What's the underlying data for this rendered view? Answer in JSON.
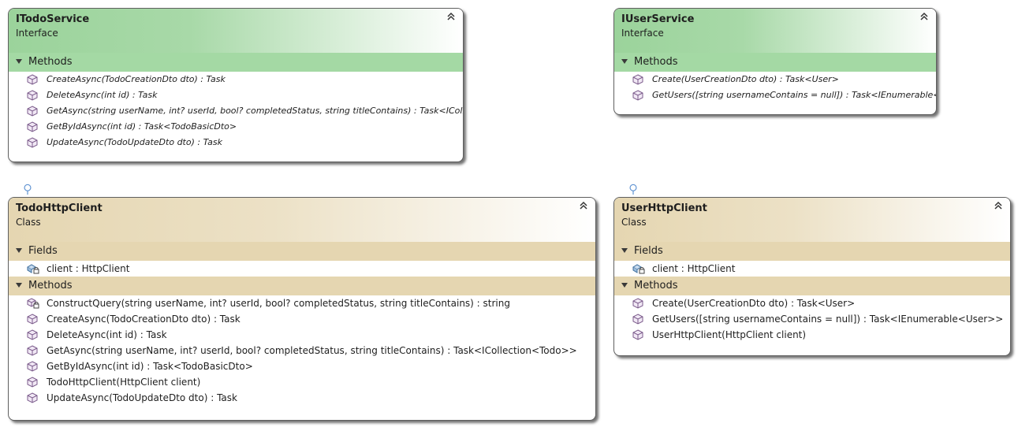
{
  "boxes": {
    "itodo": {
      "name": "ITodoService",
      "kind": "Interface",
      "sections": [
        {
          "title": "Methods",
          "members": [
            "CreateAsync(TodoCreationDto dto) : Task",
            "DeleteAsync(int id) : Task",
            "GetAsync(string userName, int? userId, bool? completedStatus, string titleContains) : Task<ICollection<Todo>>",
            "GetByIdAsync(int id) : Task<TodoBasicDto>",
            "UpdateAsync(TodoUpdateDto dto) : Task"
          ]
        }
      ]
    },
    "iuser": {
      "name": "IUserService",
      "kind": "Interface",
      "sections": [
        {
          "title": "Methods",
          "members": [
            "Create(UserCreationDto dto) : Task<User>",
            "GetUsers([string usernameContains = null]) : Task<IEnumerable<User>>"
          ]
        }
      ]
    },
    "todoclient": {
      "name": "TodoHttpClient",
      "kind": "Class",
      "sections": [
        {
          "title": "Fields",
          "members": [
            "client : HttpClient"
          ]
        },
        {
          "title": "Methods",
          "members": [
            "ConstructQuery(string userName, int? userId, bool? completedStatus, string titleContains) : string",
            "CreateAsync(TodoCreationDto dto) : Task",
            "DeleteAsync(int id) : Task",
            "GetAsync(string userName, int? userId, bool? completedStatus, string titleContains) : Task<ICollection<Todo>>",
            "GetByIdAsync(int id) : Task<TodoBasicDto>",
            "TodoHttpClient(HttpClient client)",
            "UpdateAsync(TodoUpdateDto dto) : Task"
          ]
        }
      ]
    },
    "userclient": {
      "name": "UserHttpClient",
      "kind": "Class",
      "sections": [
        {
          "title": "Fields",
          "members": [
            "client : HttpClient"
          ]
        },
        {
          "title": "Methods",
          "members": [
            "Create(UserCreationDto dto) : Task<User>",
            "GetUsers([string usernameContains = null]) : Task<IEnumerable<User>>",
            "UserHttpClient(HttpClient client)"
          ]
        }
      ]
    }
  }
}
